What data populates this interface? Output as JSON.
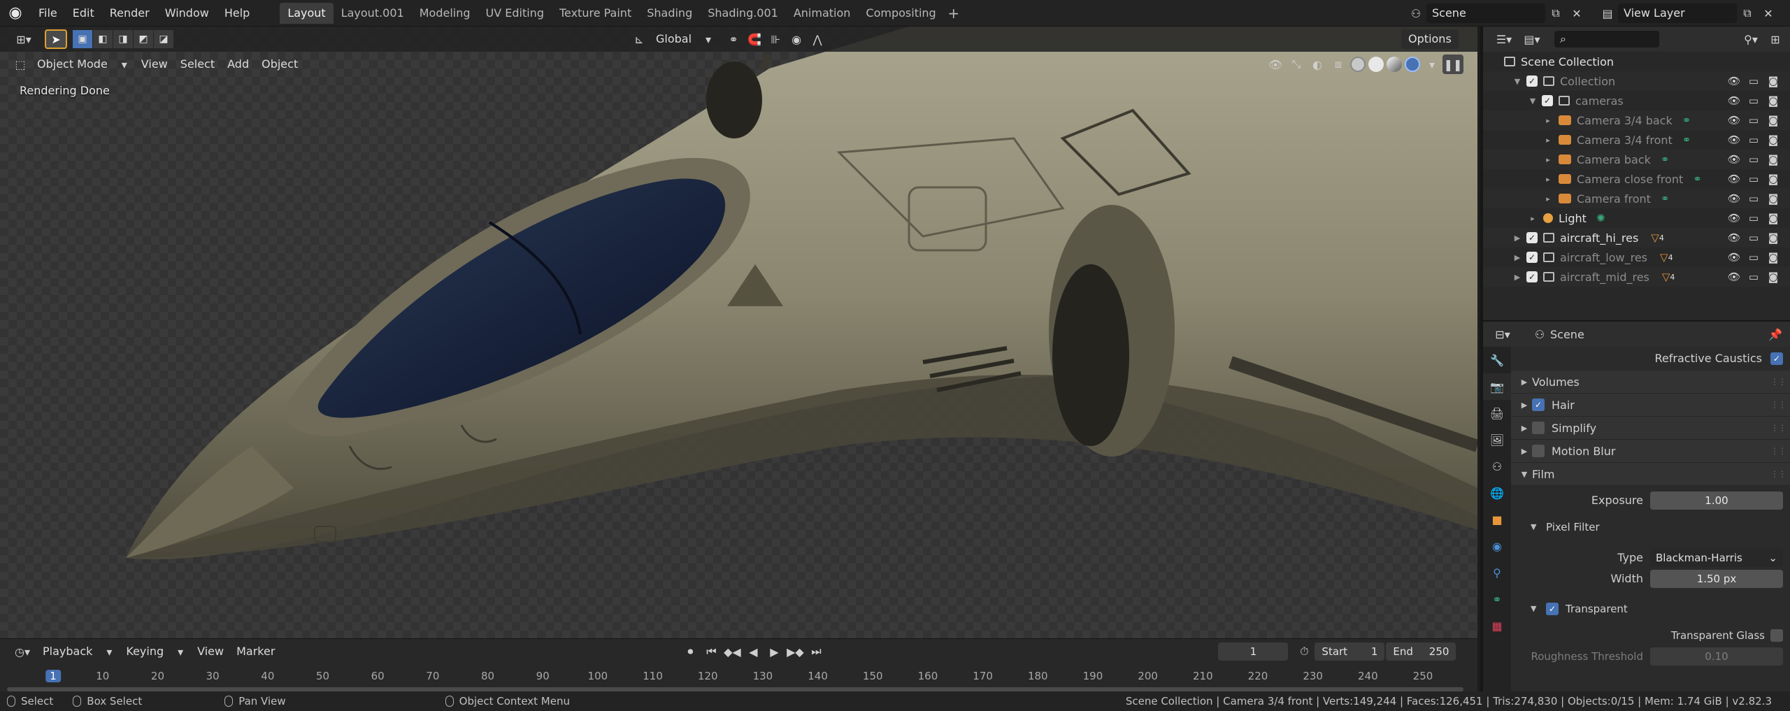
{
  "topbar": {
    "menus": [
      "File",
      "Edit",
      "Render",
      "Window",
      "Help"
    ],
    "workspaces": [
      "Layout",
      "Layout.001",
      "Modeling",
      "UV Editing",
      "Texture Paint",
      "Shading",
      "Shading.001",
      "Animation",
      "Compositing"
    ],
    "active_workspace": "Layout",
    "scene_name": "Scene",
    "view_layer": "View Layer"
  },
  "viewport": {
    "mode": "Object Mode",
    "menus": [
      "View",
      "Select",
      "Add",
      "Object"
    ],
    "orientation": "Global",
    "options_label": "Options",
    "status_text": "Rendering Done",
    "shading_mode": "rendered"
  },
  "timeline": {
    "menus": [
      "Playback",
      "Keying",
      "View",
      "Marker"
    ],
    "current_frame": "1",
    "start_label": "Start",
    "start": "1",
    "end_label": "End",
    "end": "250",
    "ticks": [
      "1",
      "10",
      "20",
      "30",
      "40",
      "50",
      "60",
      "70",
      "80",
      "90",
      "100",
      "110",
      "120",
      "130",
      "140",
      "150",
      "160",
      "170",
      "180",
      "190",
      "200",
      "210",
      "220",
      "230",
      "240",
      "250"
    ]
  },
  "statusbar": {
    "hints": [
      "Select",
      "Box Select",
      "Pan View",
      "Object Context Menu"
    ],
    "info": "Scene Collection | Camera 3/4 front | Verts:149,244 | Faces:126,451 | Tris:274,830 | Objects:0/15 | Mem: 1.74 GiB | v2.82.3"
  },
  "outliner": {
    "root": "Scene Collection",
    "rows": [
      {
        "label": "Collection",
        "depth": 1,
        "kind": "collection",
        "dim": true
      },
      {
        "label": "cameras",
        "depth": 2,
        "kind": "collection",
        "dim": true
      },
      {
        "label": "Camera 3/4 back",
        "depth": 3,
        "kind": "camera",
        "dim": true
      },
      {
        "label": "Camera 3/4 front",
        "depth": 3,
        "kind": "camera",
        "dim": true
      },
      {
        "label": "Camera back",
        "depth": 3,
        "kind": "camera",
        "dim": true
      },
      {
        "label": "Camera close front",
        "depth": 3,
        "kind": "camera",
        "dim": true
      },
      {
        "label": "Camera front",
        "depth": 3,
        "kind": "camera",
        "dim": true
      },
      {
        "label": "Light",
        "depth": 2,
        "kind": "light",
        "dim": false
      },
      {
        "label": "aircraft_hi_res",
        "depth": 1,
        "kind": "collection",
        "dim": false
      },
      {
        "label": "aircraft_low_res",
        "depth": 1,
        "kind": "collection",
        "dim": true
      },
      {
        "label": "aircraft_mid_res",
        "depth": 1,
        "kind": "collection",
        "dim": true
      }
    ],
    "mesh_count": "4"
  },
  "properties": {
    "context": "Scene",
    "refractive_caustics": "Refractive Caustics",
    "panels": {
      "volumes": "Volumes",
      "hair": "Hair",
      "simplify": "Simplify",
      "motion_blur": "Motion Blur",
      "film": "Film",
      "exposure_label": "Exposure",
      "exposure": "1.00",
      "pixel_filter": "Pixel Filter",
      "type_label": "Type",
      "type": "Blackman-Harris",
      "width_label": "Width",
      "width": "1.50 px",
      "transparent": "Transparent",
      "transparent_glass": "Transparent Glass",
      "roughness_label": "Roughness Threshold",
      "roughness": "0.10"
    }
  },
  "colors": {
    "accent": "#4772b3",
    "camera": "#d88a3a",
    "mesh": "#e8963a"
  }
}
